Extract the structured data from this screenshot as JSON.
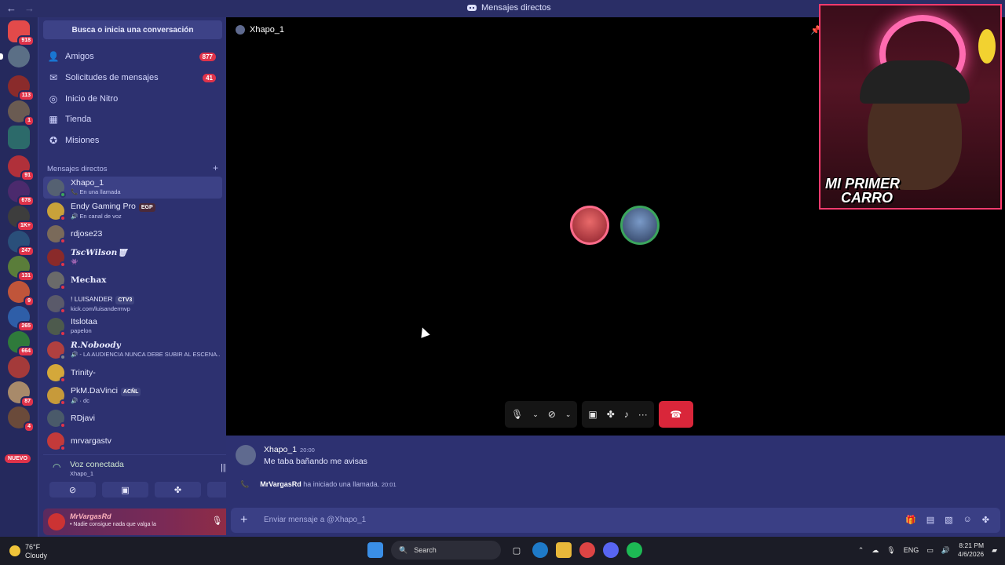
{
  "window": {
    "title": "Mensajes directos",
    "back": "←",
    "forward": "→"
  },
  "guild_badges": [
    "918",
    "113",
    "1",
    "91",
    "678",
    "1K+",
    "247",
    "131",
    "9",
    "265",
    "664",
    "87",
    "4"
  ],
  "new_badge": "NUEVO",
  "sidebar": {
    "search_label": "Busca o inicia una conversación",
    "nav": [
      {
        "label": "Amigos",
        "count": "877",
        "icon": "friends-icon"
      },
      {
        "label": "Solicitudes de mensajes",
        "count": "41",
        "icon": "mail-icon"
      },
      {
        "label": "Inicio de Nitro",
        "count": "",
        "icon": "nitro-icon"
      },
      {
        "label": "Tienda",
        "count": "",
        "icon": "shop-icon"
      },
      {
        "label": "Misiones",
        "count": "",
        "icon": "quests-icon"
      }
    ],
    "dm_header": "Mensajes directos",
    "dm_add": "+",
    "dms": [
      {
        "name": "Xhapo_1",
        "sub": "📞 En una llamada",
        "tag": ""
      },
      {
        "name": "Endy Gaming Pro",
        "sub": "🔊 En canal de voz",
        "tag": "EGP"
      },
      {
        "name": "rdjose23",
        "sub": "",
        "tag": ""
      },
      {
        "name": "TscWilson🗑",
        "sub": "👾",
        "tag": ""
      },
      {
        "name": "Mechax",
        "sub": "",
        "tag": ""
      },
      {
        "name": "! LUISANDER",
        "sub": "kick.com/luisandermvp",
        "tag": "CTV3"
      },
      {
        "name": "Itslotaa",
        "sub": "papelon",
        "tag": ""
      },
      {
        "name": "R.Noboody",
        "sub": "🔊 - LA AUDIENCIA NUNCA DEBE SUBIR AL ESCENA...",
        "tag": ""
      },
      {
        "name": "Trinity-",
        "sub": "",
        "tag": ""
      },
      {
        "name": "PkM.DaVinci",
        "sub": "🔊 · dc",
        "tag": "ACÑL"
      },
      {
        "name": "RDjavi",
        "sub": "",
        "tag": ""
      },
      {
        "name": "mrvargastv",
        "sub": "",
        "tag": ""
      }
    ]
  },
  "voice": {
    "status": "Voz conectada",
    "channel": "Xhapo_1"
  },
  "user": {
    "name": "MrVargasRd",
    "status": "• Nadie consigue nada que valga la"
  },
  "call": {
    "title": "Xhapo_1"
  },
  "webcam": {
    "caption_line1": "MI PRIMER",
    "caption_line2": "CARRO"
  },
  "chat": {
    "author": "Xhapo_1",
    "time": "20:00",
    "message": "Me taba bañando me avisas",
    "sys_who": "MrVargasRd",
    "sys_text": " ha iniciado una llamada.",
    "sys_time": "20:01",
    "placeholder": "Enviar mensaje a @Xhapo_1"
  },
  "taskbar": {
    "temp": "76°F",
    "weather": "Cloudy",
    "search": "Search",
    "lang": "ENG",
    "time": "8:21 PM",
    "date": "4/6/2026"
  },
  "colors": {
    "accent_red": "#d9263a",
    "badge_red": "#e0334a",
    "sidebar_bg": "#2d3170",
    "online_green": "#3ba55d"
  }
}
